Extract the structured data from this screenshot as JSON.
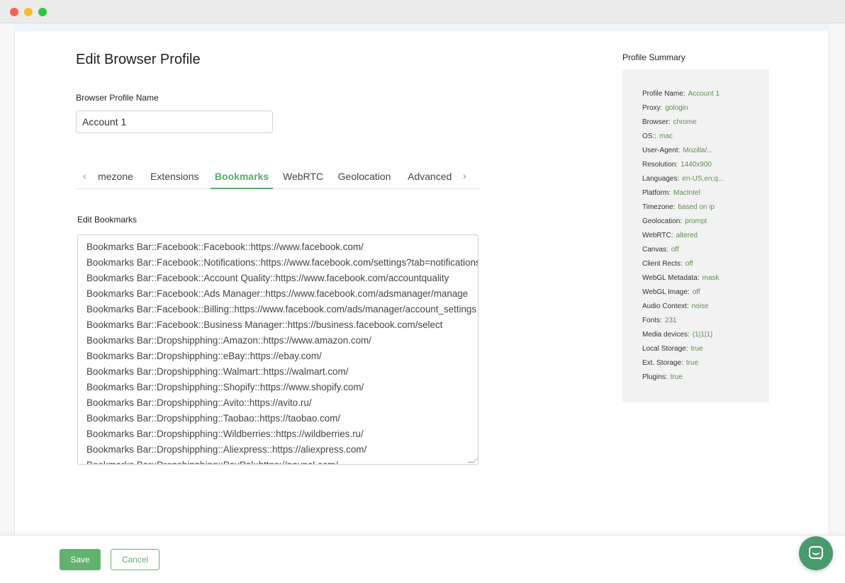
{
  "page": {
    "title": "Edit Browser Profile",
    "name_label": "Browser Profile Name",
    "name_value": "Account 1"
  },
  "tabs": {
    "items": [
      {
        "label": "mezone",
        "active": false
      },
      {
        "label": "Extensions",
        "active": false
      },
      {
        "label": "Bookmarks",
        "active": true
      },
      {
        "label": "WebRTC",
        "active": false
      },
      {
        "label": "Geolocation",
        "active": false
      },
      {
        "label": "Advanced",
        "active": false
      }
    ],
    "prev_icon": "chevron-left-icon",
    "next_icon": "chevron-right-icon"
  },
  "bookmarks": {
    "label": "Edit Bookmarks",
    "lines": [
      "Bookmarks Bar::Facebook::Facebook::https://www.facebook.com/",
      "Bookmarks Bar::Facebook::Notifications::https://www.facebook.com/settings?tab=notifications",
      "Bookmarks Bar::Facebook::Account Quality::https://www.facebook.com/accountquality",
      "Bookmarks Bar::Facebook::Ads Manager::https://www.facebook.com/adsmanager/manage",
      "Bookmarks Bar::Facebook::Billing::https://www.facebook.com/ads/manager/account_settings",
      "Bookmarks Bar::Facebook::Business Manager::https://business.facebook.com/select",
      "Bookmarks Bar::Dropshipphing::Amazon::https://www.amazon.com/",
      "Bookmarks Bar::Dropshipphing::eBay::https://ebay.com/",
      "Bookmarks Bar::Dropshipphing::Walmart::https://walmart.com/",
      "Bookmarks Bar::Dropshipphing::Shopify::https://www.shopify.com/",
      "Bookmarks Bar::Dropshipphing::Avito::https://avito.ru/",
      "Bookmarks Bar::Dropshipphing::Taobao::https://taobao.com/",
      "Bookmarks Bar::Dropshipphing::Wildberries::https://wildberries.ru/",
      "Bookmarks Bar::Dropshipphing::Aliexpress::https://aliexpress.com/",
      "Bookmarks Bar::Dropshipphing::PayPal::https://paypal.com/"
    ]
  },
  "summary": {
    "title": "Profile Summary",
    "rows": [
      {
        "key": "Profile Name:",
        "value": "Account 1"
      },
      {
        "key": "Proxy:",
        "value": "gologin"
      },
      {
        "key": "Browser:",
        "value": "chrome"
      },
      {
        "key": "OS::",
        "value": "mac"
      },
      {
        "key": "User-Agent:",
        "value": "Mozilla/..."
      },
      {
        "key": "Resolution:",
        "value": "1440x900"
      },
      {
        "key": "Languages:",
        "value": "en-US,en;q..."
      },
      {
        "key": "Platform:",
        "value": "MacIntel"
      },
      {
        "key": "Timezone:",
        "value": "based on ip"
      },
      {
        "key": "Geolocation:",
        "value": "prompt"
      },
      {
        "key": "WebRTC:",
        "value": "altered"
      },
      {
        "key": "Canvas:",
        "value": "off"
      },
      {
        "key": "Client Rects:",
        "value": "off"
      },
      {
        "key": "WebGL Metadata:",
        "value": "mask"
      },
      {
        "key": "WebGL Image:",
        "value": "off"
      },
      {
        "key": "Audio Context:",
        "value": "noise"
      },
      {
        "key": "Fonts:",
        "value": "231"
      },
      {
        "key": "Media devices:",
        "value": "(1|1|1)"
      },
      {
        "key": "Local Storage:",
        "value": "true"
      },
      {
        "key": "Ext. Storage:",
        "value": "true"
      },
      {
        "key": "Plugins:",
        "value": "true"
      }
    ]
  },
  "footer": {
    "save_label": "Save",
    "cancel_label": "Cancel"
  },
  "chat": {
    "icon": "chat-bubble-icon"
  },
  "colors": {
    "accent": "#63b170",
    "summary_value": "#5f8e52",
    "chat": "#4a9a6f"
  }
}
